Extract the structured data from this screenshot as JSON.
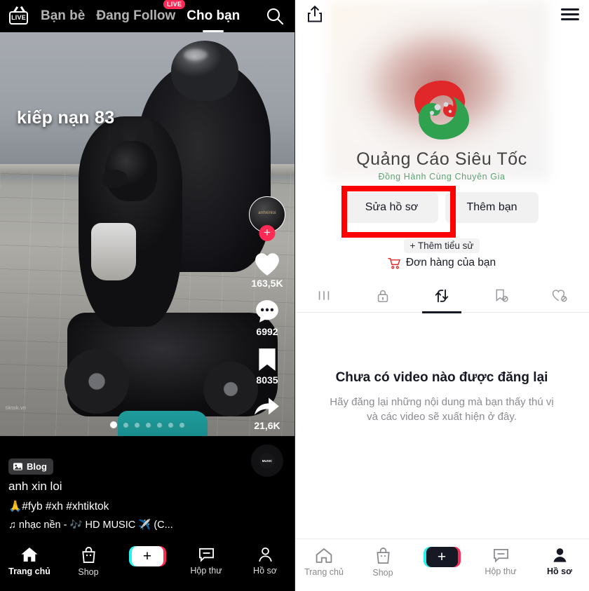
{
  "left_panel": {
    "header": {
      "live_label": "LIVE",
      "tabs": [
        {
          "label": "Bạn bè",
          "active": false,
          "badge": ""
        },
        {
          "label": "Đang Follow",
          "active": false,
          "badge": "LIVE"
        },
        {
          "label": "Cho bạn",
          "active": true,
          "badge": ""
        }
      ],
      "search_icon": "search-icon"
    },
    "video": {
      "overlay_text": "kiếp nạn 83",
      "tiny_watermark": "tiktok.vn",
      "carousel_dots": 7,
      "carousel_active_index": 0
    },
    "rail": {
      "avatar_label": "anhxinloi",
      "follow_plus": "+",
      "like_count": "163,5K",
      "comment_count": "6992",
      "bookmark_count": "8035",
      "share_count": "21,6K",
      "music_disc_label": "MUSIC"
    },
    "caption": {
      "badge_label": "Blog",
      "badge_icon": "photo-icon",
      "title": "anh xin loi",
      "hashtags": "🙏#fyb #xh #xhtiktok",
      "music": "♫ nhạc nền - 🎶 HD MUSIC ✈️ (C..."
    },
    "bottom_nav": [
      {
        "label": "Trang chủ",
        "icon": "home-icon",
        "active": true
      },
      {
        "label": "Shop",
        "icon": "shop-bag-icon",
        "active": false
      },
      {
        "label": "",
        "icon": "create-plus-icon",
        "active": false
      },
      {
        "label": "Hộp thư",
        "icon": "inbox-icon",
        "active": false
      },
      {
        "label": "Hồ sơ",
        "icon": "person-icon",
        "active": false
      }
    ]
  },
  "right_panel": {
    "header": {
      "share_icon": "share-icon",
      "menu_icon": "hamburger-menu-icon"
    },
    "watermark": {
      "title": "Quảng Cáo Siêu Tốc",
      "subtitle": "Đồng Hành Cùng Chuyên Gia",
      "logo_name": "swirl-logo-icon",
      "color_red": "#e0282a",
      "color_green": "#2fa14f"
    },
    "actions": {
      "edit_profile_label": "Sửa hồ sơ",
      "add_friend_label": "Thêm bạn",
      "add_bio_label": "+ Thêm tiểu sử",
      "orders_label": "Đơn hàng của bạn",
      "orders_icon": "cart-icon"
    },
    "tabs": [
      {
        "icon": "grid-posts-icon",
        "active": false
      },
      {
        "icon": "lock-private-icon",
        "active": false
      },
      {
        "icon": "repost-icon",
        "active": true
      },
      {
        "icon": "bookmark-off-icon",
        "active": false
      },
      {
        "icon": "heart-off-icon",
        "active": false
      }
    ],
    "empty_state": {
      "title": "Chưa có video nào được đăng lại",
      "subtitle": "Hãy đăng lại những nội dung mà bạn thấy thú vị và các video sẽ xuất hiện ở đây."
    },
    "bottom_nav": [
      {
        "label": "Trang chủ",
        "icon": "home-icon",
        "active": false
      },
      {
        "label": "Shop",
        "icon": "shop-bag-icon",
        "active": false
      },
      {
        "label": "",
        "icon": "create-plus-icon",
        "active": false
      },
      {
        "label": "Hộp thư",
        "icon": "inbox-icon",
        "active": false
      },
      {
        "label": "Hồ sơ",
        "icon": "person-icon",
        "active": true
      }
    ]
  },
  "annotations": {
    "highlight_color": "#fe0000",
    "boxes": [
      {
        "name": "edit-profile-highlight"
      },
      {
        "name": "profile-nav-highlight"
      }
    ]
  }
}
